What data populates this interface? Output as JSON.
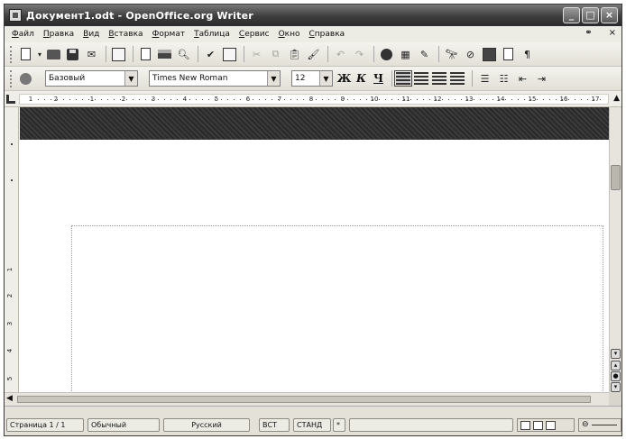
{
  "window": {
    "title": "Документ1.odt - OpenOffice.org Writer",
    "controls": {
      "minimize": "_",
      "maximize": "□",
      "close": "×"
    }
  },
  "menu": {
    "items": [
      "Файл",
      "Правка",
      "Вид",
      "Вставка",
      "Формат",
      "Таблица",
      "Сервис",
      "Окно",
      "Справка"
    ],
    "close_doc": "×"
  },
  "toolbar_standard": {
    "icons": [
      "new-document-icon",
      "open-icon",
      "save-icon",
      "email-icon",
      "edit-mode-icon",
      "export-pdf-icon",
      "print-icon",
      "page-preview-icon",
      "spellcheck-icon",
      "autospellcheck-icon",
      "cut-icon",
      "copy-icon",
      "paste-icon",
      "format-paintbrush-icon",
      "undo-icon",
      "redo-icon",
      "hyperlink-icon",
      "table-icon",
      "draw-icon",
      "find-icon",
      "navigator-icon",
      "gallery-icon",
      "datasource-icon",
      "formatting-marks-icon"
    ]
  },
  "toolbar_formatting": {
    "style": "Базовый",
    "font": "Times New Roman",
    "size": "12",
    "bold": "Ж",
    "italic": "К",
    "underline": "Ч"
  },
  "ruler": {
    "marks": [
      "1",
      "2",
      "1",
      "2",
      "3",
      "4",
      "5",
      "6",
      "7",
      "8",
      "9",
      "10",
      "11",
      "12",
      "13",
      "14",
      "15",
      "16",
      "17"
    ],
    "vertical_marks": [
      "1",
      "2",
      "3",
      "4",
      "5"
    ]
  },
  "status": {
    "page": "Страница 1 / 1",
    "page_style": "Обычный",
    "language": "Русский",
    "insert_mode": "ВСТ",
    "selection_mode": "СТАНД",
    "modified": "*"
  }
}
